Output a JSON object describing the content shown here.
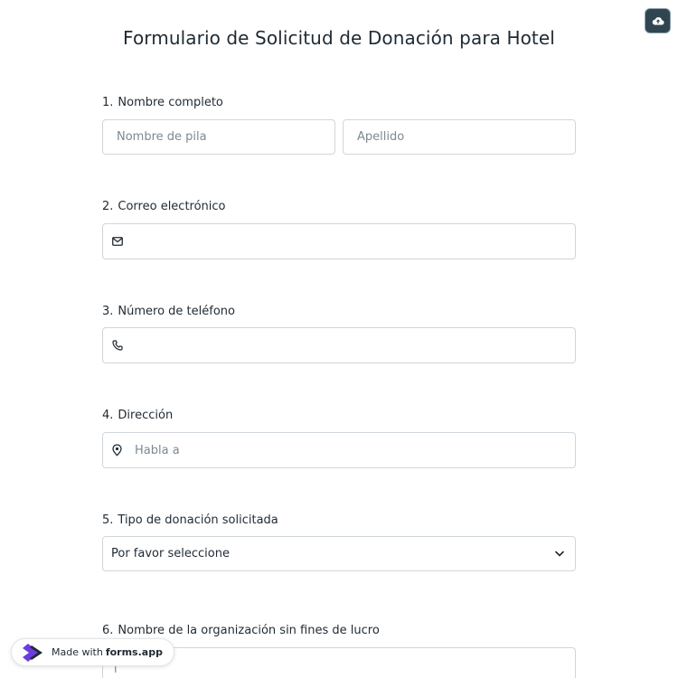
{
  "form": {
    "title": "Formulario de Solicitud de Donación para Hotel"
  },
  "questions": [
    {
      "number": "1.",
      "label": "Nombre completo",
      "first_placeholder": "Nombre de pila",
      "last_placeholder": "Apellido"
    },
    {
      "number": "2.",
      "label": "Correo electrónico",
      "icon": "envelope-icon"
    },
    {
      "number": "3.",
      "label": "Número de teléfono",
      "icon": "phone-icon"
    },
    {
      "number": "4.",
      "label": "Dirección",
      "icon": "location-pin-icon",
      "placeholder": "Habla a"
    },
    {
      "number": "5.",
      "label": "Tipo de donación solicitada",
      "selected": "Por favor seleccione"
    },
    {
      "number": "6.",
      "label": "Nombre de la organización sin fines de lucro",
      "value": "I"
    }
  ],
  "badge": {
    "prefix": "Made with",
    "brand": "forms.app"
  },
  "toolbar": {
    "cloud_icon": "cloud-upload-icon"
  },
  "colors": {
    "cloud_button_bg": "#2f4650",
    "border": "#cfd6db",
    "text": "#1f2a33",
    "placeholder": "#7d8991",
    "logo_purple": "#6c3ce0"
  }
}
